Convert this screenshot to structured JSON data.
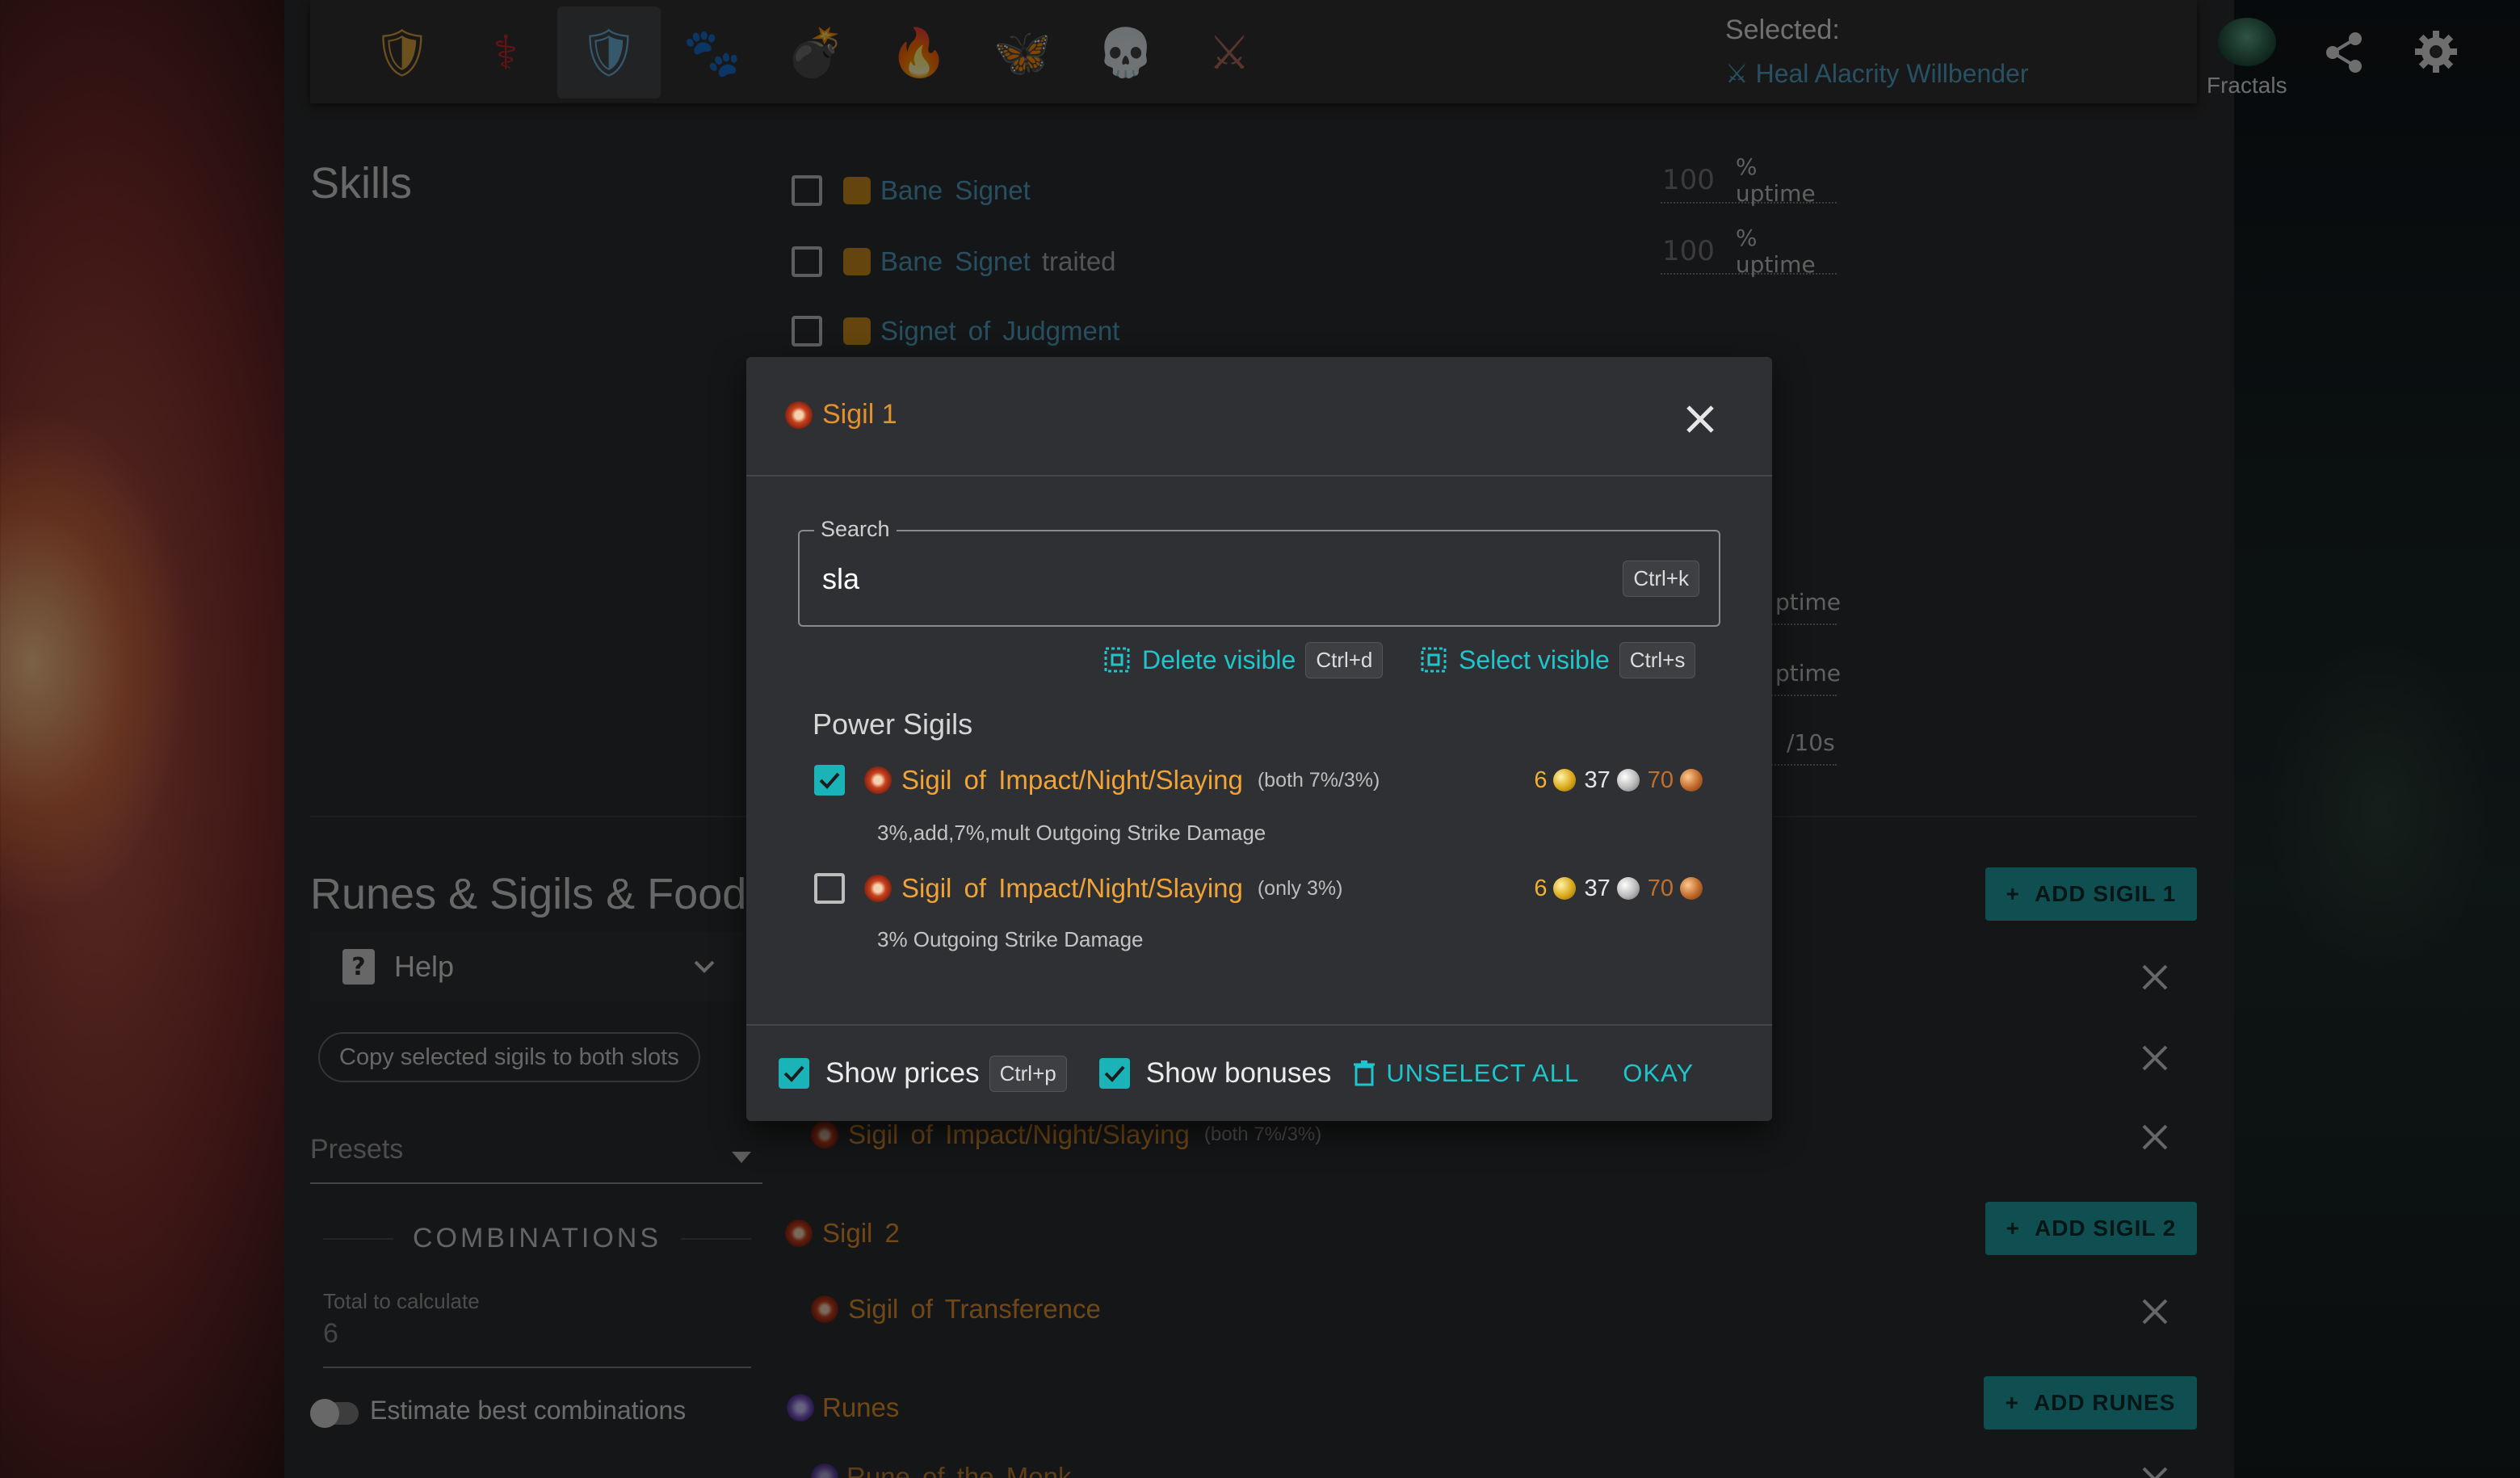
{
  "topbar": {
    "professions": [
      {
        "name": "guardian-icon",
        "glyph": "🛡"
      },
      {
        "name": "revenant-icon",
        "glyph": "⚕"
      },
      {
        "name": "guardian-selected-icon",
        "glyph": "🛡"
      },
      {
        "name": "ranger-icon",
        "glyph": "🐾"
      },
      {
        "name": "engineer-icon",
        "glyph": "💣"
      },
      {
        "name": "elementalist-icon",
        "glyph": "🔥"
      },
      {
        "name": "mesmer-icon",
        "glyph": "🦋"
      },
      {
        "name": "necromancer-icon",
        "glyph": "💀"
      },
      {
        "name": "warrior-icon",
        "glyph": "⚔"
      }
    ],
    "selected_label": "Selected:",
    "selected_build": "Heal Alacrity Willbender",
    "fractals_label": "Fractals"
  },
  "skills": {
    "title": "Skills",
    "rows": [
      {
        "name": "Bane Signet",
        "extra": "",
        "uptime": "100",
        "unit": "% uptime"
      },
      {
        "name": "Bane Signet",
        "extra": "traited",
        "uptime": "100",
        "unit": "% uptime"
      },
      {
        "name": "Signet of Judgment",
        "extra": "",
        "uptime": "",
        "unit": ""
      }
    ],
    "partial_units": [
      "ptime",
      "ptime",
      "/10s"
    ]
  },
  "runes_section": {
    "title": "Runes & Sigils & Food",
    "help_label": "Help",
    "copy_chip": "Copy selected sigils to both slots",
    "presets_placeholder": "Presets",
    "combinations_heading": "COMBINATIONS",
    "total_label": "Total to calculate",
    "total_value": "6",
    "estimate_label": "Estimate best combinations",
    "add_sigil1": "ADD SIGIL 1",
    "add_sigil2": "ADD SIGIL 2",
    "add_runes": "ADD RUNES",
    "sigil1_item": {
      "name": "Sigil of Impact/Night/Slaying",
      "note": "(both 7%/3%)"
    },
    "sigil2_label": "Sigil 2",
    "sigil2_item": "Sigil of Transference",
    "runes_label": "Runes",
    "runes_item_partial": "Rune of the Monk"
  },
  "modal": {
    "title": "Sigil 1",
    "search_legend": "Search",
    "search_value": "sla",
    "search_shortcut": "Ctrl+k",
    "delete_visible": "Delete visible",
    "delete_shortcut": "Ctrl+d",
    "select_visible": "Select visible",
    "select_shortcut": "Ctrl+s",
    "section": "Power Sigils",
    "options": [
      {
        "checked": true,
        "name": "Sigil of Impact/Night/Slaying",
        "tag": "(both 7%/3%)",
        "bonus": "3%,add,7%,mult Outgoing Strike Damage",
        "gold": "6",
        "silver": "37",
        "copper": "70"
      },
      {
        "checked": false,
        "name": "Sigil of Impact/Night/Slaying",
        "tag": "(only 3%)",
        "bonus": "3% Outgoing Strike Damage",
        "gold": "6",
        "silver": "37",
        "copper": "70"
      }
    ],
    "footer": {
      "show_prices": "Show prices",
      "prices_shortcut": "Ctrl+p",
      "show_bonuses": "Show bonuses",
      "unselect_all": "UNSELECT ALL",
      "okay": "OKAY"
    }
  },
  "colors": {
    "accent": "#1ec5cc",
    "sigil": "#f0a336",
    "link": "#4f9fc0"
  }
}
